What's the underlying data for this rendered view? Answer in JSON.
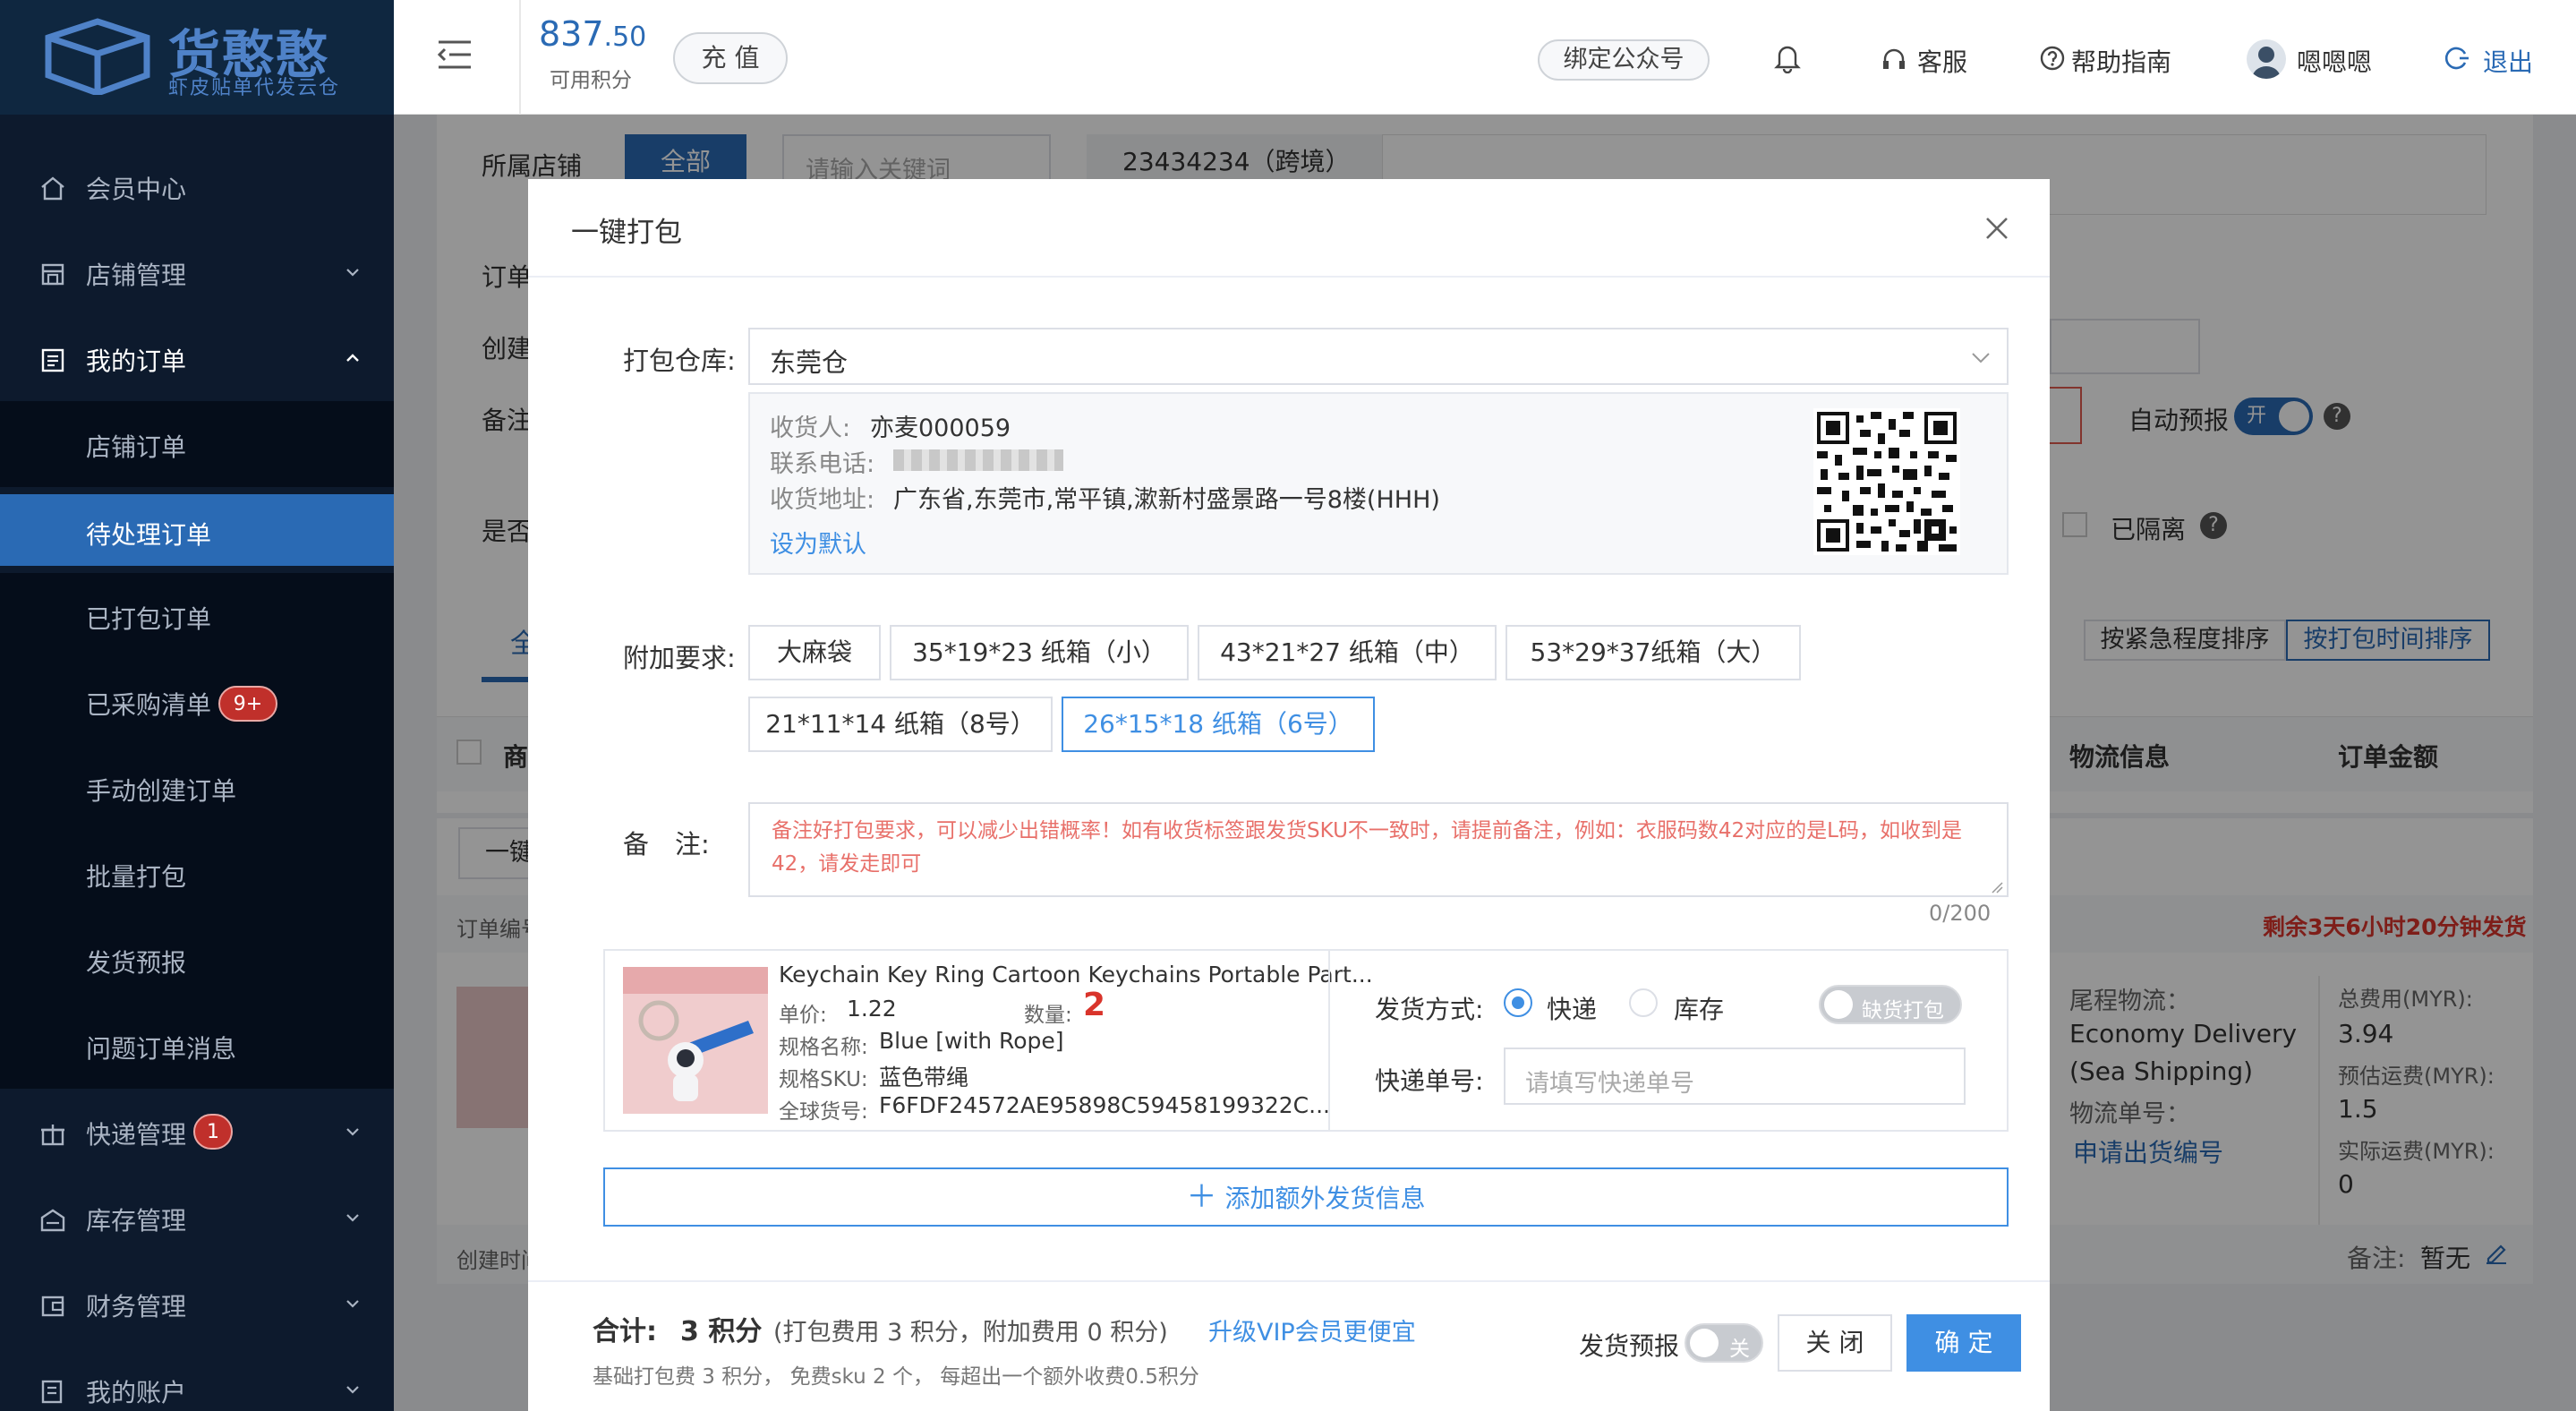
{
  "app": {
    "logo_title": "货憨憨",
    "logo_subtitle": "虾皮贴单代发云仓"
  },
  "sidebar": {
    "items": [
      {
        "label": "会员中心",
        "icon": "home-icon"
      },
      {
        "label": "店铺管理",
        "icon": "store-icon"
      },
      {
        "label": "我的订单",
        "icon": "order-list-icon"
      },
      {
        "label": "快递管理",
        "icon": "gift-icon",
        "badge": "1"
      },
      {
        "label": "库存管理",
        "icon": "warehouse-icon"
      },
      {
        "label": "财务管理",
        "icon": "wallet-icon"
      },
      {
        "label": "我的账户",
        "icon": "account-icon"
      }
    ],
    "subitems": [
      {
        "label": "店铺订单"
      },
      {
        "label": "待处理订单"
      },
      {
        "label": "已打包订单"
      },
      {
        "label": "已采购清单",
        "badge": "9+"
      },
      {
        "label": "手动创建订单"
      },
      {
        "label": "批量打包"
      },
      {
        "label": "发货预报"
      },
      {
        "label": "问题订单消息"
      }
    ]
  },
  "topbar": {
    "points_int": "837",
    "points_dec": ".50",
    "points_label": "可用积分",
    "recharge": "充 值",
    "bind_wechat": "绑定公众号",
    "service": "客服",
    "help": "帮助指南",
    "username": "嗯嗯嗯",
    "logout": "退出"
  },
  "background": {
    "shop_label": "所属店铺",
    "shop_all": "全部",
    "shop_search_placeholder": "请输入关键词",
    "shop_tag": "23434234（跨境）",
    "row_order": "订单",
    "row_create": "创建",
    "row_note": "备注",
    "row_whether": "是否",
    "auto_forecast": "自动预报",
    "auto_forecast_toggle": "开",
    "isolated": "已隔离",
    "sort_urgency": "按紧急程度排序",
    "sort_time": "按打包时间排序",
    "col_goods": "商",
    "col_logistics": "物流信息",
    "col_amount": "订单金额",
    "onekey_btn": "一键",
    "order_no": "订单编号",
    "countdown": "剩余3天6小时20分钟发货",
    "tail_logistics_label": "尾程物流：",
    "tail_logistics_value1": "Economy Delivery",
    "tail_logistics_value2": "(Sea Shipping)",
    "tracking_label": "物流单号：",
    "apply_tracking": "申请出货编号",
    "total_fee_label": "总费用(MYR):",
    "total_fee": "3.94",
    "est_fee_label": "预估运费(MYR):",
    "est_fee": "1.5",
    "actual_fee_label": "实际运费(MYR):",
    "actual_fee": "0",
    "create_time": "创建时间",
    "note_label": "备注:",
    "note_value": "暂无",
    "tab_all": "全"
  },
  "modal": {
    "title": "一键打包",
    "warehouse_label": "打包仓库:",
    "warehouse_value": "东莞仓",
    "receiver_label": "收货人:",
    "receiver_value": "亦麦000059",
    "phone_label": "联系电话:",
    "address_label": "收货地址:",
    "address_value": "广东省,东莞市,常平镇,漱新村盛景路一号8楼(HHH)",
    "set_default": "设为默认",
    "extra_label": "附加要求:",
    "extra_options": [
      {
        "label": "大麻袋",
        "selected": false
      },
      {
        "label": "35*19*23 纸箱（小）",
        "selected": false
      },
      {
        "label": "43*21*27 纸箱（中）",
        "selected": false
      },
      {
        "label": "53*29*37纸箱（大）",
        "selected": false
      },
      {
        "label": "21*11*14 纸箱（8号）",
        "selected": false
      },
      {
        "label": "26*15*18 纸箱（6号）",
        "selected": true
      }
    ],
    "note_label": "备　注:",
    "note_placeholder": "备注好打包要求，可以减少出错概率！如有收货标签跟发货SKU不一致时，请提前备注，例如：衣服码数42对应的是L码，如收到是42，请发走即可",
    "note_count": "0/200",
    "product": {
      "title": "Keychain Key Ring Cartoon Keychains Portable Part...",
      "price_label": "单价:",
      "price": "1.22",
      "qty_label": "数量:",
      "qty": "2",
      "spec_label": "规格名称:",
      "spec": "Blue [with Rope]",
      "sku_label": "规格SKU:",
      "sku": "蓝色带绳",
      "global_label": "全球货号:",
      "global": "F6FDF24572AE95898C59458199322C..."
    },
    "ship_method_label": "发货方式:",
    "ship_express": "快递",
    "ship_stock": "库存",
    "missing_pack": "缺货打包",
    "tracking_label": "快递单号:",
    "tracking_placeholder": "请填写快递单号",
    "add_extra": "添加额外发货信息",
    "total_label": "合计:",
    "total_value": "3 积分",
    "total_detail": "(打包费用 3 积分，附加费用 0 积分)",
    "upgrade_vip": "升级VIP会员更便宜",
    "fee_note": "基础打包费 3 积分， 免费sku 2 个， 每超出一个额外收费0.5积分",
    "forecast_label": "发货预报",
    "forecast_toggle": "关",
    "close_btn": "关 闭",
    "confirm_btn": "确 定"
  },
  "colors": {
    "accent": "#3f8fe3",
    "sidebar_bg": "#0d1a2d",
    "danger": "#d9342b"
  }
}
